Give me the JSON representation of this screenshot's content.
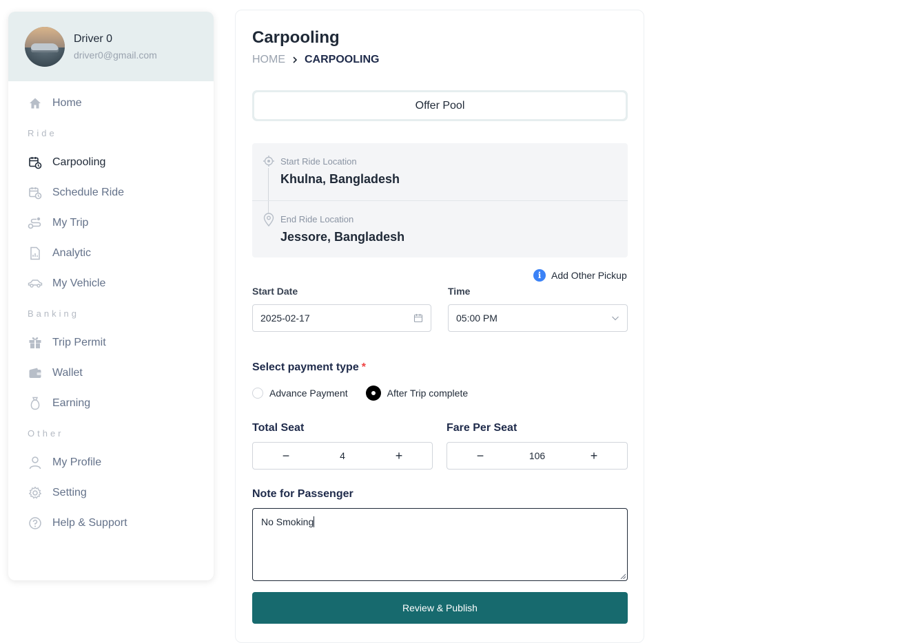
{
  "sidebar": {
    "profile": {
      "name": "Driver 0",
      "email": "driver0@gmail.com"
    },
    "items": [
      {
        "type": "item",
        "label": "Home",
        "icon": "home-icon"
      },
      {
        "type": "section",
        "label": "Ride"
      },
      {
        "type": "item",
        "label": "Carpooling",
        "icon": "calendar-clock-icon",
        "active": true
      },
      {
        "type": "item",
        "label": "Schedule Ride",
        "icon": "calendar-clock-icon"
      },
      {
        "type": "item",
        "label": "My Trip",
        "icon": "route-icon"
      },
      {
        "type": "item",
        "label": "Analytic",
        "icon": "document-chart-icon"
      },
      {
        "type": "item",
        "label": "My Vehicle",
        "icon": "car-icon"
      },
      {
        "type": "section",
        "label": "Banking"
      },
      {
        "type": "item",
        "label": "Trip Permit",
        "icon": "gift-icon"
      },
      {
        "type": "item",
        "label": "Wallet",
        "icon": "wallet-icon"
      },
      {
        "type": "item",
        "label": "Earning",
        "icon": "money-bag-icon"
      },
      {
        "type": "section",
        "label": "Other"
      },
      {
        "type": "item",
        "label": "My Profile",
        "icon": "user-icon"
      },
      {
        "type": "item",
        "label": "Setting",
        "icon": "gear-icon"
      },
      {
        "type": "item",
        "label": "Help & Support",
        "icon": "help-circle-icon"
      }
    ]
  },
  "main": {
    "title": "Carpooling",
    "breadcrumb": {
      "home": "HOME",
      "current": "CARPOOLING"
    },
    "offer_pool_label": "Offer Pool",
    "start_location": {
      "label": "Start Ride Location",
      "value": "Khulna, Bangladesh"
    },
    "end_location": {
      "label": "End Ride Location",
      "value": "Jessore, Bangladesh"
    },
    "add_pickup_label": "Add Other Pickup",
    "start_date": {
      "label": "Start Date",
      "value": "2025-02-17"
    },
    "time": {
      "label": "Time",
      "value": "05:00 PM"
    },
    "payment": {
      "label": "Select payment type",
      "required_mark": "*",
      "options": [
        "Advance Payment",
        "After Trip complete"
      ],
      "selected": "After Trip complete"
    },
    "total_seat": {
      "label": "Total Seat",
      "value": "4",
      "minus": "−",
      "plus": "+"
    },
    "fare_per_seat": {
      "label": "Fare Per Seat",
      "value": "106",
      "minus": "−",
      "plus": "+"
    },
    "note": {
      "label": "Note for Passenger",
      "value": "No Smoking"
    },
    "publish_label": "Review & Publish"
  },
  "colors": {
    "accent": "#176a6e",
    "profile_bg": "#e6eeef",
    "info": "#3b82f6",
    "required": "#ef4444"
  }
}
